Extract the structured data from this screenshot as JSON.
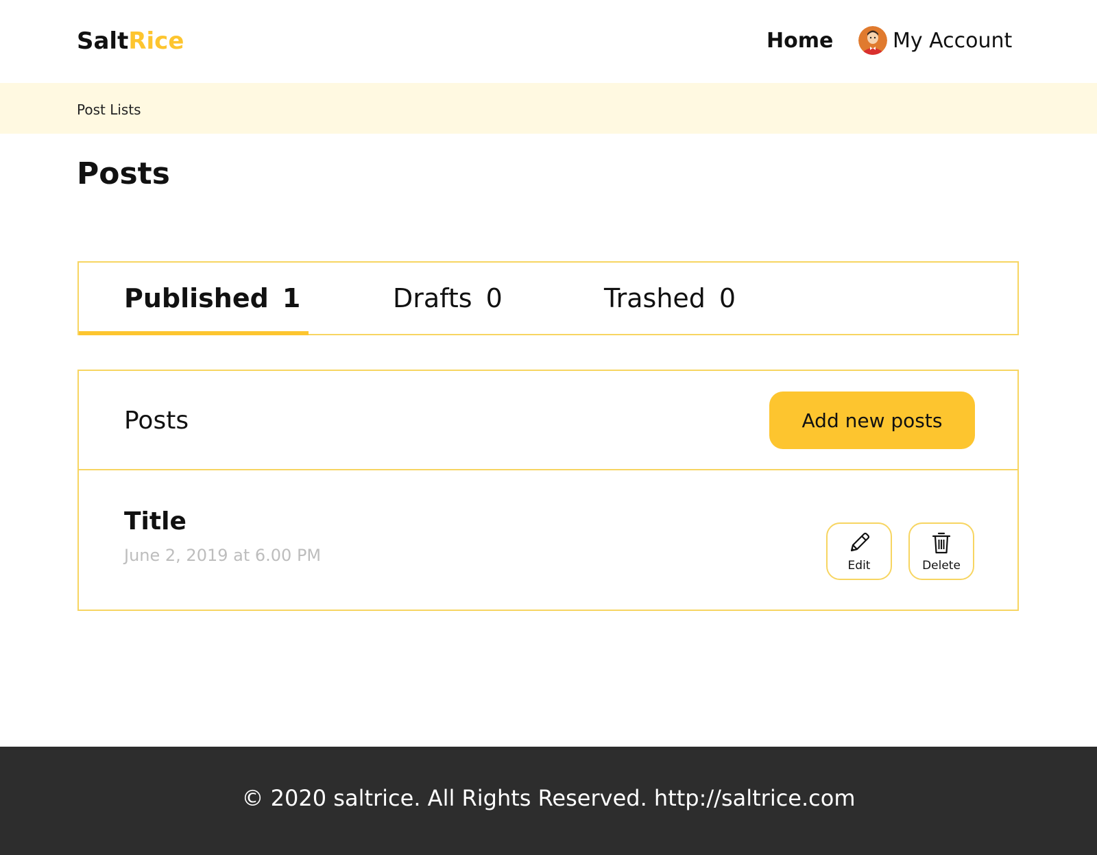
{
  "header": {
    "logo_part1": "Salt",
    "logo_part2": "Rice",
    "nav_home": "Home",
    "nav_account": "My Account",
    "avatar_icon": "user-avatar-icon"
  },
  "breadcrumb": "Post Lists",
  "page_title": "Posts",
  "tabs": [
    {
      "label": "Published",
      "count": "1",
      "active": true
    },
    {
      "label": "Drafts",
      "count": "0",
      "active": false
    },
    {
      "label": "Trashed",
      "count": "0",
      "active": false
    }
  ],
  "posts_panel": {
    "title": "Posts",
    "add_button": "Add new posts",
    "items": [
      {
        "title": "Title",
        "date": "June 2, 2019 at 6.00 PM",
        "edit_label": "Edit",
        "edit_icon": "pencil-icon",
        "delete_label": "Delete",
        "delete_icon": "trash-icon"
      }
    ]
  },
  "footer": {
    "text": "© 2020 saltrice. All Rights Reserved. http://saltrice.com"
  },
  "colors": {
    "accent": "#FDC52F",
    "border": "#F7D561",
    "breadcrumb_bg": "#FFF9E1",
    "footer_bg": "#2D2D2D",
    "muted_text": "#BDBDBD"
  }
}
